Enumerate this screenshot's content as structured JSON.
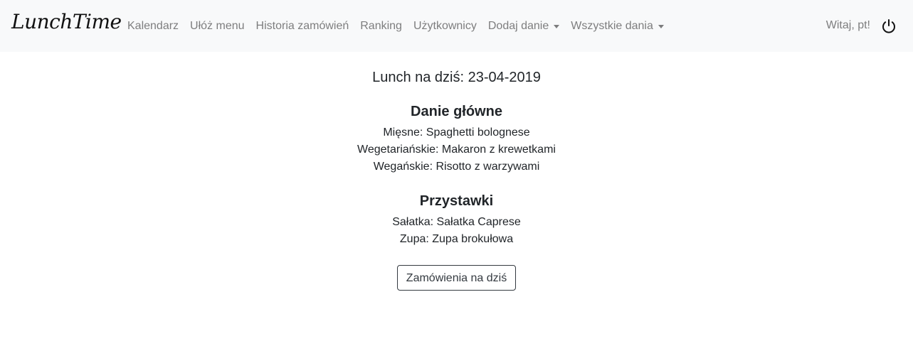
{
  "navbar": {
    "brand": "LunchTime",
    "links": [
      {
        "label": "Kalendarz"
      },
      {
        "label": "Ułóż menu"
      },
      {
        "label": "Historia zamówień"
      },
      {
        "label": "Ranking"
      },
      {
        "label": "Użytkownicy"
      },
      {
        "label": "Dodaj danie"
      },
      {
        "label": "Wszystkie dania"
      }
    ],
    "greeting": "Witaj, pt!",
    "logout_icon": "power-icon"
  },
  "main": {
    "title": "Lunch na dziś: 23-04-2019",
    "sections": [
      {
        "heading": "Danie główne",
        "items": [
          "Mięsne: Spaghetti bolognese",
          "Wegetariańskie: Makaron z krewetkami",
          "Wegańskie: Risotto z warzywami"
        ]
      },
      {
        "heading": "Przystawki",
        "items": [
          "Sałatka: Sałatka Caprese",
          "Zupa: Zupa brokułowa"
        ]
      }
    ],
    "orders_button": "Zamówienia na dziś"
  },
  "colors": {
    "navbar_bg": "#f8f9fa",
    "nav_text": "rgba(0,0,0,0.5)",
    "text": "#212529",
    "button_border": "#343a40"
  }
}
